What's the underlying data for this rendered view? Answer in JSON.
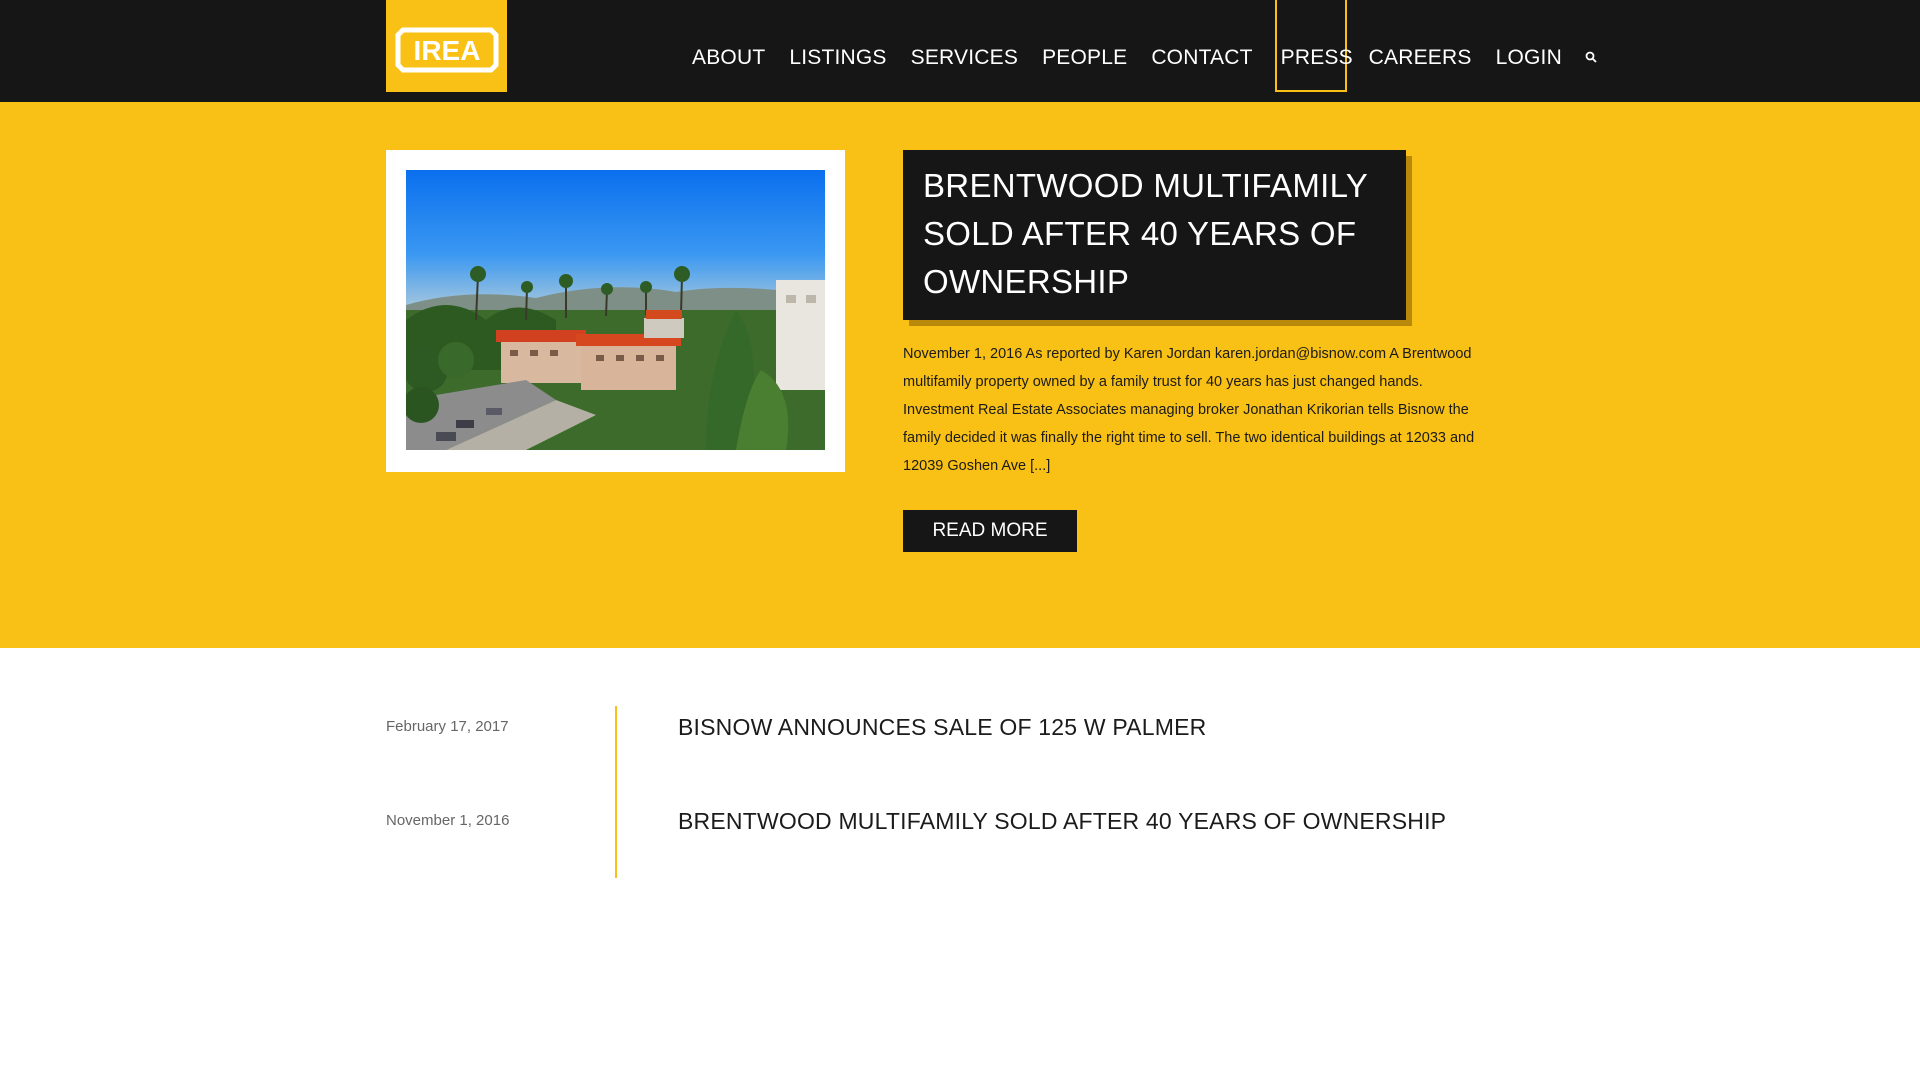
{
  "brand": {
    "logo_text": "IREA",
    "accent_color": "#f9c015",
    "dark_color": "#161616"
  },
  "nav": {
    "items": [
      {
        "label": "ABOUT"
      },
      {
        "label": "LISTINGS"
      },
      {
        "label": "SERVICES"
      },
      {
        "label": "PEOPLE"
      },
      {
        "label": "CONTACT"
      },
      {
        "label": "PRESS",
        "active": true
      },
      {
        "label": "CAREERS"
      },
      {
        "label": "LOGIN"
      }
    ],
    "search_icon": "search-icon"
  },
  "feature": {
    "title": "BRENTWOOD MULTIFAMILY SOLD AFTER 40 YEARS OF OWNERSHIP",
    "excerpt": "November 1, 2016 As reported by Karen Jordan karen.jordan@bisnow.com A Brentwood multifamily property owned by a family trust for 40 years has just changed hands. Investment Real Estate Associates managing broker Jonathan Krikorian tells Bisnow the family decided it was finally the right time to sell. The two identical buildings at 12033 and 12039 Goshen Ave [...]",
    "read_more_label": "READ MORE"
  },
  "press_list": [
    {
      "date": "February 17, 2017",
      "title": "BISNOW ANNOUNCES SALE OF 125 W PALMER"
    },
    {
      "date": "November 1, 2016",
      "title": "BRENTWOOD MULTIFAMILY SOLD AFTER 40 YEARS OF OWNERSHIP"
    }
  ]
}
